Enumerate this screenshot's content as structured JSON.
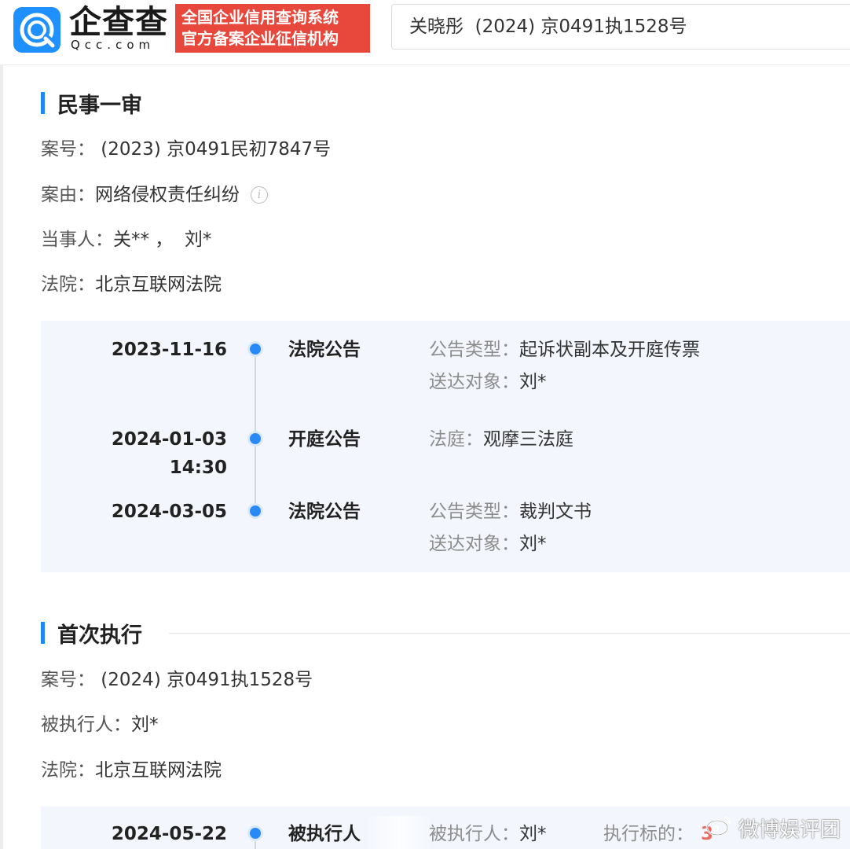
{
  "header": {
    "logo_name": "企查查",
    "logo_domain": "Qcc.com",
    "cert_line1": "全国企业信用查询系统",
    "cert_line2": "官方备案企业征信机构",
    "search_value": "关晓彤  (2024) 京0491执1528号"
  },
  "section1": {
    "title": "民事一审",
    "case_no_label": "案号：",
    "case_no_value": " (2023) 京0491民初7847号",
    "cause_label": "案由：",
    "cause_value": "网络侵权责任纠纷",
    "parties_label": "当事人：",
    "parties_value": "关** ，  刘*",
    "court_label": "法院：",
    "court_value": "北京互联网法院",
    "timeline": [
      {
        "date": "2023-11-16",
        "time": "",
        "type": "法院公告",
        "details": [
          {
            "k": "公告类型：",
            "v": "起诉状副本及开庭传票"
          },
          {
            "k": "送达对象：",
            "v": "刘*"
          }
        ]
      },
      {
        "date": "2024-01-03",
        "time": "14:30",
        "type": "开庭公告",
        "details": [
          {
            "k": "法庭：",
            "v": "观摩三法庭"
          }
        ]
      },
      {
        "date": "2024-03-05",
        "time": "",
        "type": "法院公告",
        "details": [
          {
            "k": "公告类型：",
            "v": "裁判文书"
          },
          {
            "k": "送达对象：",
            "v": "刘*"
          }
        ]
      }
    ]
  },
  "section2": {
    "title": "首次执行",
    "case_no_label": "案号：",
    "case_no_value": " (2024) 京0491执1528号",
    "debtor_label": "被执行人：",
    "debtor_value": "刘*",
    "court_label": "法院：",
    "court_value": "北京互联网法院",
    "timeline": [
      {
        "date": "2024-05-22",
        "type": "被执行人",
        "detail_k": "被执行人：",
        "detail_v": "刘*",
        "detail2_k": "执行标的：",
        "detail2_v": "3"
      }
    ]
  },
  "watermark": {
    "text": "微博娱评团"
  },
  "colors": {
    "accent": "#1e88f5",
    "brand_red": "#e8473c",
    "timeline_bg": "#f3f7fd",
    "dot": "#2a8af5"
  }
}
